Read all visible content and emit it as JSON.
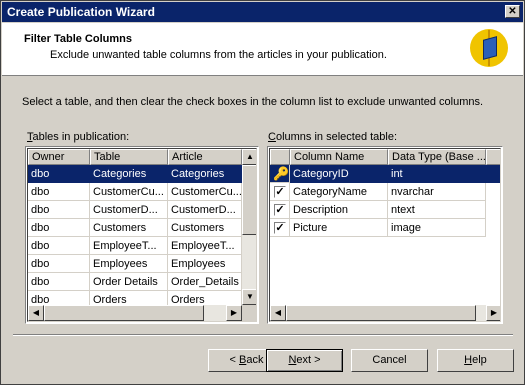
{
  "window": {
    "title": "Create Publication Wizard",
    "close_glyph": "✕"
  },
  "header": {
    "title": "Filter Table Columns",
    "subtitle": "Exclude unwanted table columns from the articles in your publication.",
    "icon": "publication-book-icon"
  },
  "instruction": "Select a table, and then clear the check boxes in the column list to exclude unwanted columns.",
  "tables_label": {
    "mnemonic": "T",
    "rest": "ables in publication:"
  },
  "tables": {
    "columns": [
      "Owner",
      "Table",
      "Article"
    ],
    "rows": [
      {
        "owner": "dbo",
        "table": "Categories",
        "article": "Categories",
        "selected": true
      },
      {
        "owner": "dbo",
        "table": "CustomerCu...",
        "article": "CustomerCu...",
        "selected": false
      },
      {
        "owner": "dbo",
        "table": "CustomerD...",
        "article": "CustomerD...",
        "selected": false
      },
      {
        "owner": "dbo",
        "table": "Customers",
        "article": "Customers",
        "selected": false
      },
      {
        "owner": "dbo",
        "table": "EmployeeT...",
        "article": "EmployeeT...",
        "selected": false
      },
      {
        "owner": "dbo",
        "table": "Employees",
        "article": "Employees",
        "selected": false
      },
      {
        "owner": "dbo",
        "table": "Order Details",
        "article": "Order_Details",
        "selected": false
      },
      {
        "owner": "dbo",
        "table": "Orders",
        "article": "Orders",
        "selected": false
      }
    ]
  },
  "columns_label": {
    "mnemonic": "C",
    "rest": "olumns in selected table:"
  },
  "column_list": {
    "columns": [
      "",
      "Column Name",
      "Data Type (Base ..."
    ],
    "rows": [
      {
        "name": "CategoryID",
        "type": "int",
        "checked": true,
        "key": true,
        "selected": true
      },
      {
        "name": "CategoryName",
        "type": "nvarchar",
        "checked": true,
        "key": false,
        "selected": false
      },
      {
        "name": "Description",
        "type": "ntext",
        "checked": true,
        "key": false,
        "selected": false
      },
      {
        "name": "Picture",
        "type": "image",
        "checked": true,
        "key": false,
        "selected": false
      }
    ]
  },
  "buttons": {
    "back": {
      "prefix": "< ",
      "mnemonic": "B",
      "rest": "ack"
    },
    "next": {
      "mnemonic": "N",
      "rest": "ext >"
    },
    "cancel": "Cancel",
    "help": {
      "mnemonic": "H",
      "rest": "elp"
    }
  },
  "glyphs": {
    "up": "▲",
    "down": "▼",
    "left": "◀",
    "right": "▶",
    "check": "✓",
    "key": "🔑"
  },
  "colors": {
    "titlebar": "#0a246a",
    "selection": "#0a246a",
    "face": "#d4d0c8",
    "icon_bg": "#f0c400"
  }
}
